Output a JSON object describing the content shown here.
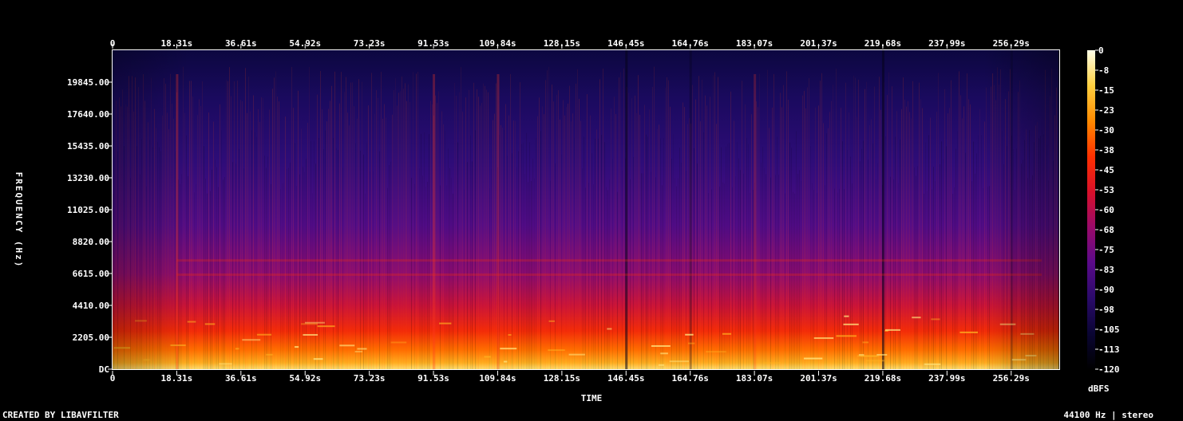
{
  "chart_data": {
    "type": "heatmap",
    "xlabel": "TIME",
    "ylabel": "FREQUENCY (Hz)",
    "x_ticks": [
      "0",
      "18.31s",
      "36.61s",
      "54.92s",
      "73.23s",
      "91.53s",
      "109.84s",
      "128.15s",
      "146.45s",
      "164.76s",
      "183.07s",
      "201.37s",
      "219.68s",
      "237.99s",
      "256.29s"
    ],
    "y_ticks": [
      "DC",
      "2205.00",
      "4410.00",
      "6615.00",
      "8820.00",
      "11025.00",
      "13230.00",
      "15435.00",
      "17640.00",
      "19845.00"
    ],
    "y_tick_values": [
      0,
      2205,
      4410,
      6615,
      8820,
      11025,
      13230,
      15435,
      17640,
      19845
    ],
    "ylim": [
      0,
      22050
    ],
    "xlim": [
      0,
      270
    ],
    "colorbar": {
      "label": "dBFS",
      "ticks": [
        "0",
        "-8",
        "-15",
        "-23",
        "-30",
        "-38",
        "-45",
        "-53",
        "-60",
        "-68",
        "-75",
        "-83",
        "-90",
        "-98",
        "-105",
        "-113",
        "-120"
      ],
      "range": [
        -120,
        0
      ]
    },
    "colormap": [
      "#000000",
      "#0a0533",
      "#2a0a6a",
      "#5a0a8a",
      "#9a0a6a",
      "#d8102a",
      "#ff3000",
      "#ff8a00",
      "#ffd040",
      "#ffffe8"
    ],
    "events": [
      {
        "time": 18.31,
        "level": 0.9
      },
      {
        "time": 91.53,
        "level": 0.85
      },
      {
        "time": 109.84,
        "level": 0.85
      },
      {
        "time": 146.45,
        "level": -0.7
      },
      {
        "time": 164.76,
        "level": -0.4
      },
      {
        "time": 183.07,
        "level": 0.7
      },
      {
        "time": 219.68,
        "level": -0.7
      },
      {
        "time": 256.29,
        "level": -0.3
      }
    ]
  },
  "footer": {
    "left": "CREATED BY LIBAVFILTER",
    "right": "44100 Hz | stereo"
  }
}
